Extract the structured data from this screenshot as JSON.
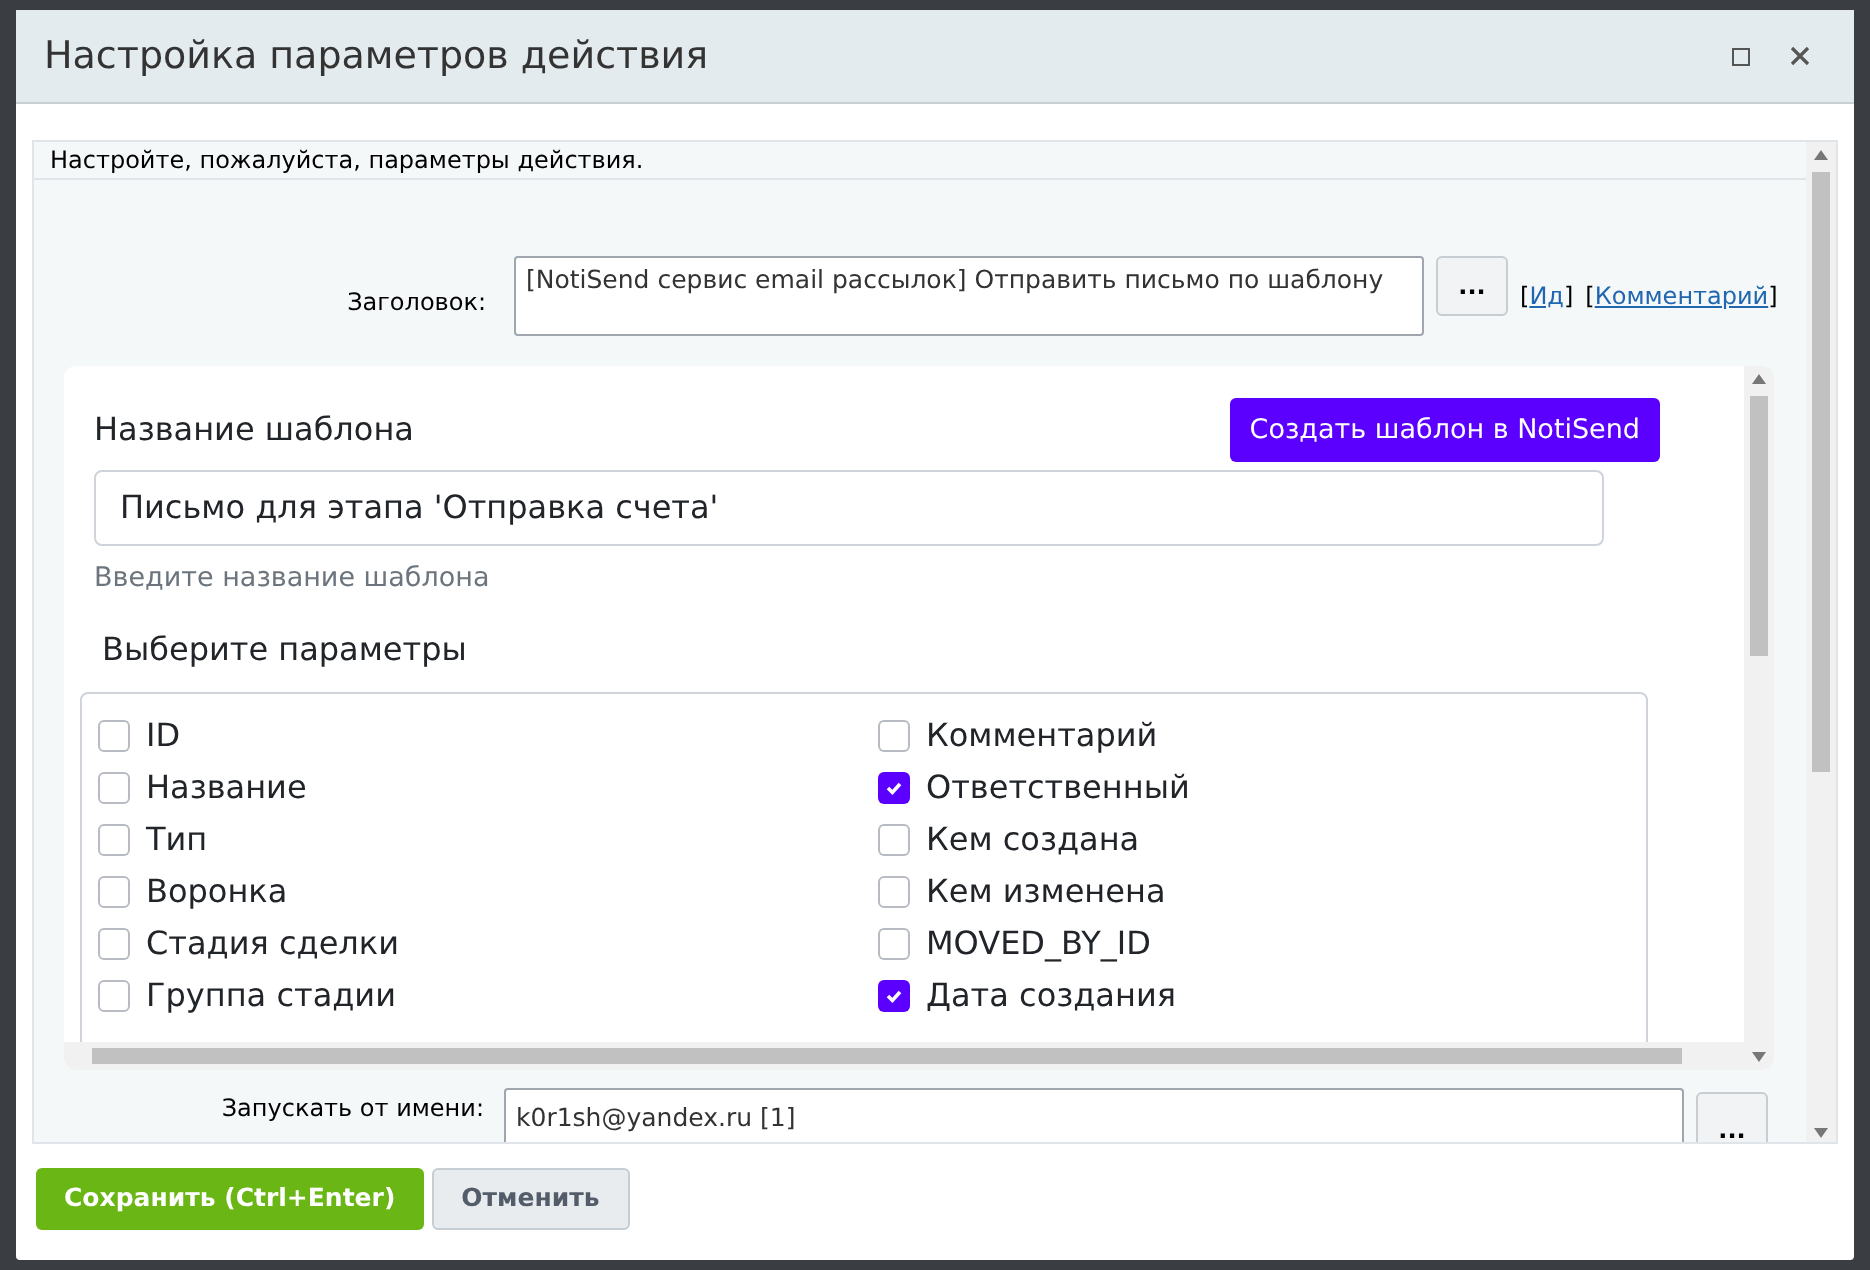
{
  "window": {
    "title": "Настройка параметров действия"
  },
  "intro": "Настройте, пожалуйста, параметры действия.",
  "title_field": {
    "label": "Заголовок:",
    "value": "[NotiSend сервис email рассылок] Отправить письмо по шаблону",
    "dots": "...",
    "links": [
      "Ид",
      "Комментарий"
    ],
    "link_brackets": [
      "[",
      "]"
    ]
  },
  "template": {
    "heading": "Название шаблона",
    "create_button": "Создать шаблон в NotiSend",
    "value": "Письмо для этапа 'Отправка счета'",
    "hint": "Введите название шаблона",
    "params_heading": "Выберите параметры",
    "params": [
      {
        "label": "ID",
        "checked": false
      },
      {
        "label": "Название",
        "checked": false
      },
      {
        "label": "Тип",
        "checked": false
      },
      {
        "label": "Воронка",
        "checked": false
      },
      {
        "label": "Стадия сделки",
        "checked": false
      },
      {
        "label": "Группа стадии",
        "checked": false
      },
      {
        "label": "Комментарий",
        "checked": false
      },
      {
        "label": "Ответственный",
        "checked": true
      },
      {
        "label": "Кем создана",
        "checked": false
      },
      {
        "label": "Кем изменена",
        "checked": false
      },
      {
        "label": "MOVED_BY_ID",
        "checked": false
      },
      {
        "label": "Дата создания",
        "checked": true
      }
    ]
  },
  "run_as": {
    "label": "Запускать от имени:",
    "value": "k0r1sh@yandex.ru [1]",
    "dots": "..."
  },
  "buttons": [
    "Сохранить (Ctrl+Enter)",
    "Отменить"
  ]
}
